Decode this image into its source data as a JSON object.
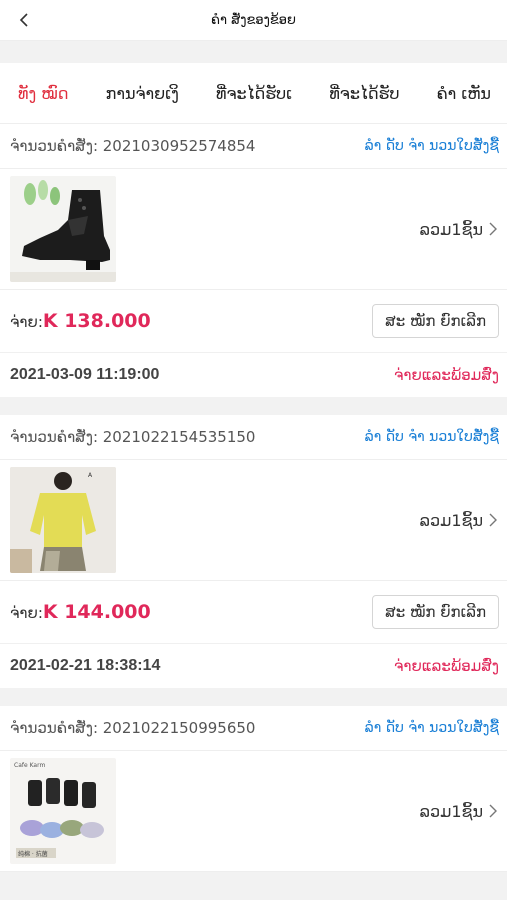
{
  "header": {
    "title": "ຄຳ ສັ່ງຂອງຂ້ອຍ"
  },
  "tabs": [
    {
      "label": "ທັງ ໝົດ",
      "active": true
    },
    {
      "label": "ການຈ່າຍເງິ"
    },
    {
      "label": "ທີ່ຈະໄດ້ຮັບເ"
    },
    {
      "label": "ທີ່ຈະໄດ້ຮັບ"
    },
    {
      "label": "ຄຳ ເຫັນ"
    }
  ],
  "orders": [
    {
      "order_no": "ຈຳນວນຄຳສັ່ງ:  2021030952574854",
      "link": "ລຳ ດັບ ຈຳ ນວນໃບສັ່ງຊື້",
      "count": "ລວມ1ຊິ້ນ",
      "pay_label": "ຈ່າຍ:",
      "amount": "K 138.000",
      "cancel": "ສະ ໝັກ ຍົກເລີກ",
      "datetime": "2021-03-09 11:19:00",
      "status": "ຈ່າຍແລະພ້ອມສົ່ງ"
    },
    {
      "order_no": "ຈຳນວນຄຳສັ່ງ:  2021022154535150",
      "link": "ລຳ ດັບ ຈຳ ນວນໃບສັ່ງຊື້",
      "count": "ລວມ1ຊິ້ນ",
      "pay_label": "ຈ່າຍ:",
      "amount": "K 144.000",
      "cancel": "ສະ ໝັກ ຍົກເລີກ",
      "datetime": "2021-02-21 18:38:14",
      "status": "ຈ່າຍແລະພ້ອມສົ່ງ"
    },
    {
      "order_no": "ຈຳນວນຄຳສັ່ງ:  2021022150995650",
      "link": "ລຳ ດັບ ຈຳ ນວນໃບສັ່ງຊື້",
      "count": "ລວມ1ຊິ້ນ",
      "thumb_caption_top": "Cafe Karm",
      "thumb_caption_bottom": "纯棉 · 抗菌"
    }
  ]
}
